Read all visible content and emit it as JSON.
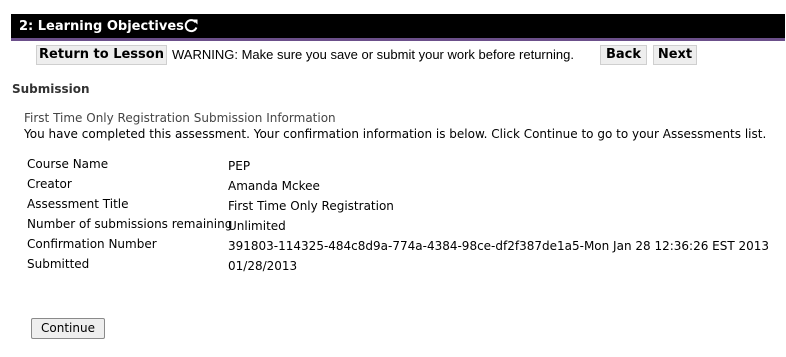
{
  "header": {
    "title": "2: Learning Objectives",
    "refresh_icon": "refresh-icon"
  },
  "navbar": {
    "return_label": "Return to Lesson",
    "warning": "WARNING: Make sure you save or submit your work before returning.",
    "back_label": "Back",
    "next_label": "Next"
  },
  "main": {
    "section_heading": "Submission",
    "sub_heading": "First Time Only Registration Submission Information",
    "intro": "You have completed this assessment. Your confirmation information is below. Click Continue to go to your Assessments list.",
    "rows": [
      {
        "label": "Course Name",
        "value": "PEP"
      },
      {
        "label": "Creator",
        "value": "Amanda Mckee"
      },
      {
        "label": "Assessment Title",
        "value": "First Time Only Registration"
      },
      {
        "label": "Number of submissions remaining",
        "value": "Unlimited"
      },
      {
        "label": "Confirmation Number",
        "value": "391803-114325-484c8d9a-774a-4384-98ce-df2f387de1a5-Mon Jan 28 12:36:26 EST 2013"
      },
      {
        "label": "Submitted",
        "value": "01/28/2013"
      }
    ],
    "continue_label": "Continue"
  },
  "colors": {
    "header_bg": "#000000",
    "header_accent": "#6b4f8a",
    "button_bg": "#eeeeee"
  }
}
